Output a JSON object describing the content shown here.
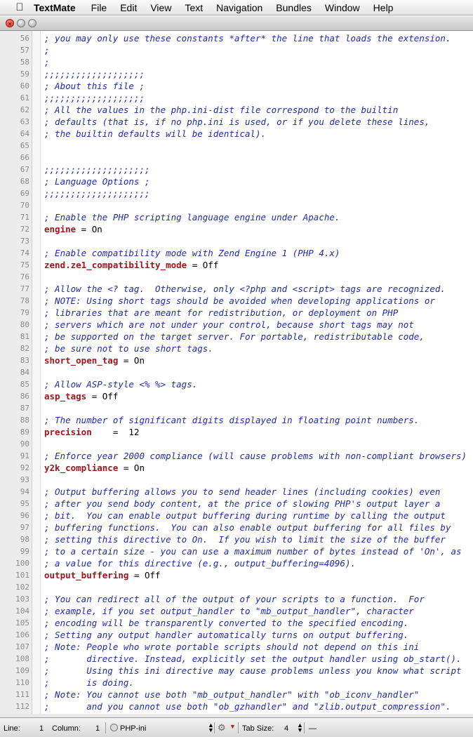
{
  "menubar": {
    "apple_icon": "apple-logo-icon",
    "app": "TextMate",
    "items": [
      "File",
      "Edit",
      "View",
      "Text",
      "Navigation",
      "Bundles",
      "Window",
      "Help"
    ]
  },
  "window": {
    "close_glyph": "×",
    "min_glyph": "",
    "zoom_glyph": ""
  },
  "editor": {
    "lines": [
      {
        "n": "56",
        "t": "c",
        "text": "; you may only use these constants *after* the line that loads the extension."
      },
      {
        "n": "57",
        "t": "c",
        "text": ";"
      },
      {
        "n": "58",
        "t": "c",
        "text": ";"
      },
      {
        "n": "59",
        "t": "c",
        "text": ";;;;;;;;;;;;;;;;;;;"
      },
      {
        "n": "60",
        "t": "c",
        "text": "; About this file ;"
      },
      {
        "n": "61",
        "t": "c",
        "text": ";;;;;;;;;;;;;;;;;;;"
      },
      {
        "n": "62",
        "t": "c",
        "text": "; All the values in the php.ini-dist file correspond to the builtin"
      },
      {
        "n": "63",
        "t": "c",
        "text": "; defaults (that is, if no php.ini is used, or if you delete these lines,"
      },
      {
        "n": "64",
        "t": "c",
        "text": "; the builtin defaults will be identical)."
      },
      {
        "n": "65",
        "t": "b",
        "text": ""
      },
      {
        "n": "66",
        "t": "b",
        "text": ""
      },
      {
        "n": "67",
        "t": "c",
        "text": ";;;;;;;;;;;;;;;;;;;;"
      },
      {
        "n": "68",
        "t": "c",
        "text": "; Language Options ;"
      },
      {
        "n": "69",
        "t": "c",
        "text": ";;;;;;;;;;;;;;;;;;;;"
      },
      {
        "n": "70",
        "t": "b",
        "text": ""
      },
      {
        "n": "71",
        "t": "c",
        "text": "; Enable the PHP scripting language engine under Apache."
      },
      {
        "n": "72",
        "t": "k",
        "key": "engine",
        "rest": " = On"
      },
      {
        "n": "73",
        "t": "b",
        "text": ""
      },
      {
        "n": "74",
        "t": "c",
        "text": "; Enable compatibility mode with Zend Engine 1 (PHP 4.x)"
      },
      {
        "n": "75",
        "t": "k",
        "key": "zend.ze1_compatibility_mode",
        "rest": " = Off"
      },
      {
        "n": "76",
        "t": "b",
        "text": ""
      },
      {
        "n": "77",
        "t": "c",
        "text": "; Allow the <? tag.  Otherwise, only <?php and <script> tags are recognized."
      },
      {
        "n": "78",
        "t": "c",
        "text": "; NOTE: Using short tags should be avoided when developing applications or"
      },
      {
        "n": "79",
        "t": "c",
        "text": "; libraries that are meant for redistribution, or deployment on PHP"
      },
      {
        "n": "80",
        "t": "c",
        "text": "; servers which are not under your control, because short tags may not"
      },
      {
        "n": "81",
        "t": "c",
        "text": "; be supported on the target server. For portable, redistributable code,"
      },
      {
        "n": "82",
        "t": "c",
        "text": "; be sure not to use short tags."
      },
      {
        "n": "83",
        "t": "k",
        "key": "short_open_tag",
        "rest": " = On"
      },
      {
        "n": "84",
        "t": "b",
        "text": ""
      },
      {
        "n": "85",
        "t": "c",
        "text": "; Allow ASP-style <% %> tags."
      },
      {
        "n": "86",
        "t": "k",
        "key": "asp_tags",
        "rest": " = Off"
      },
      {
        "n": "87",
        "t": "b",
        "text": ""
      },
      {
        "n": "88",
        "t": "c",
        "text": "; The number of significant digits displayed in floating point numbers."
      },
      {
        "n": "89",
        "t": "k",
        "key": "precision",
        "rest": "    =  12"
      },
      {
        "n": "90",
        "t": "b",
        "text": ""
      },
      {
        "n": "91",
        "t": "c",
        "text": "; Enforce year 2000 compliance (will cause problems with non-compliant browsers)"
      },
      {
        "n": "92",
        "t": "k",
        "key": "y2k_compliance",
        "rest": " = On"
      },
      {
        "n": "93",
        "t": "b",
        "text": ""
      },
      {
        "n": "94",
        "t": "c",
        "text": "; Output buffering allows you to send header lines (including cookies) even"
      },
      {
        "n": "95",
        "t": "c",
        "text": "; after you send body content, at the price of slowing PHP's output layer a"
      },
      {
        "n": "96",
        "t": "c",
        "text": "; bit.  You can enable output buffering during runtime by calling the output"
      },
      {
        "n": "97",
        "t": "c",
        "text": "; buffering functions.  You can also enable output buffering for all files by"
      },
      {
        "n": "98",
        "t": "c",
        "text": "; setting this directive to On.  If you wish to limit the size of the buffer"
      },
      {
        "n": "99",
        "t": "c",
        "text": "; to a certain size - you can use a maximum number of bytes instead of 'On', as"
      },
      {
        "n": "100",
        "t": "c",
        "text": "; a value for this directive (e.g., output_buffering=4096)."
      },
      {
        "n": "101",
        "t": "k",
        "key": "output_buffering",
        "rest": " = Off"
      },
      {
        "n": "102",
        "t": "b",
        "text": ""
      },
      {
        "n": "103",
        "t": "c",
        "text": "; You can redirect all of the output of your scripts to a function.  For"
      },
      {
        "n": "104",
        "t": "c",
        "text": "; example, if you set output_handler to \"mb_output_handler\", character"
      },
      {
        "n": "105",
        "t": "c",
        "text": "; encoding will be transparently converted to the specified encoding."
      },
      {
        "n": "106",
        "t": "c",
        "text": "; Setting any output handler automatically turns on output buffering."
      },
      {
        "n": "107",
        "t": "c",
        "text": "; Note: People who wrote portable scripts should not depend on this ini"
      },
      {
        "n": "108",
        "t": "c",
        "text": ";       directive. Instead, explicitly set the output handler using ob_start()."
      },
      {
        "n": "109",
        "t": "c",
        "text": ";       Using this ini directive may cause problems unless you know what script"
      },
      {
        "n": "110",
        "t": "c",
        "text": ";       is doing."
      },
      {
        "n": "111",
        "t": "c",
        "text": "; Note: You cannot use both \"mb_output_handler\" with \"ob_iconv_handler\""
      },
      {
        "n": "112",
        "t": "c",
        "text": ";       and you cannot use both \"ob_gzhandler\" and \"zlib.output_compression\"."
      }
    ]
  },
  "statusbar": {
    "line_label": "Line:",
    "line_value": "1",
    "column_label": "Column:",
    "column_value": "1",
    "language": "PHP-ini",
    "tab_size_label": "Tab Size:",
    "tab_size_value": "4",
    "symbol_placeholder": "—"
  },
  "colors": {
    "comment": "#1f2ca8",
    "key": "#a0141a"
  }
}
